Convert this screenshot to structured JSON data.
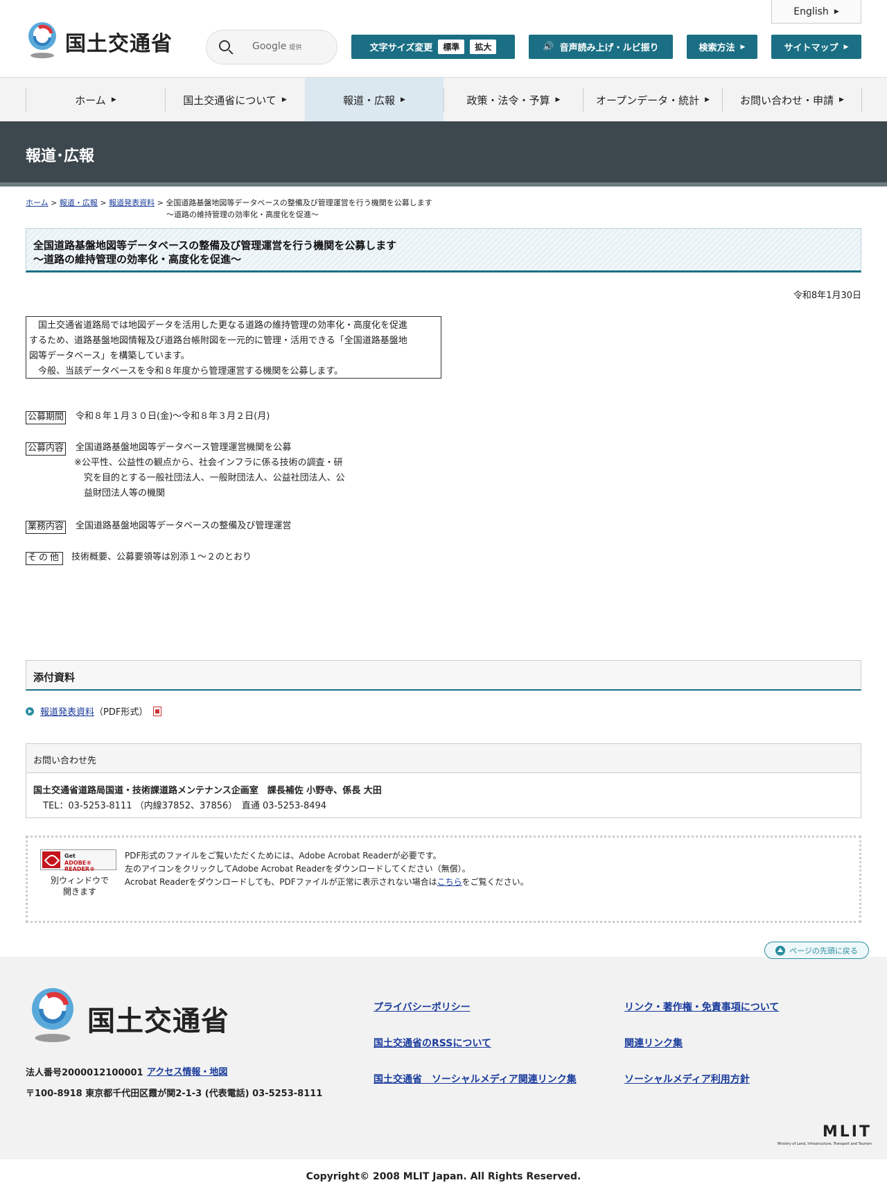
{
  "header": {
    "logo_text": "国土交通省",
    "search_placeholder": "Google",
    "search_provided": "提供",
    "english_label": "English",
    "font_size_label": "文字サイズ変更",
    "font_standard": "標準",
    "font_large": "拡大",
    "voice_label": "音声読み上げ・ルビ振り",
    "search_method_label": "検索方法",
    "sitemap_label": "サイトマップ"
  },
  "nav": {
    "items": [
      {
        "label": "ホーム"
      },
      {
        "label": "国土交通省について"
      },
      {
        "label": "報道・広報"
      },
      {
        "label": "政策・法令・予算"
      },
      {
        "label": "オープンデータ・統計"
      },
      {
        "label": "お問い合わせ・申請"
      }
    ]
  },
  "banner": {
    "title": "報道･広報"
  },
  "breadcrumb": {
    "home": "ホーム",
    "press": "報道・広報",
    "releases": "報道発表資料",
    "current_line1": "全国道路基盤地図等データベースの整備及び管理運営を行う機関を公募します",
    "current_line2": "～道路の維持管理の効率化・高度化を促進～"
  },
  "article": {
    "title_line1": "全国道路基盤地図等データベースの整備及び管理運営を行う機関を公募します",
    "title_line2": "～道路の維持管理の効率化・高度化を促進～",
    "date": "令和8年1月30日",
    "summary": [
      "　国土交通省道路局では地図データを活用した更なる道路の維持管理の効率化・高度化を促進",
      "するため、道路基盤地図情報及び道路台帳附図を一元的に管理・活用できる「全国道路基盤地",
      "図等データベース」を構築しています。",
      "　今般、当該データベースを令和８年度から管理運営する機関を公募します。"
    ],
    "period_label": "公募期間",
    "period_value": "令和８年１月３０日(金)～令和８年３月２日(月)",
    "content_label": "公募内容",
    "content_value": "全国道路基盤地図等データベース管理運営機関を公募",
    "content_note": [
      "※公平性、公益性の観点から、社会インフラに係る技術の調査・研",
      "究を目的とする一般社団法人、一般財団法人、公益社団法人、公",
      "益財団法人等の機関"
    ],
    "work_label": "業務内容",
    "work_value": "全国道路基盤地図等データベースの整備及び管理運営",
    "other_label": "その他",
    "other_value": "技術概要、公募要領等は別添１～２のとおり"
  },
  "attachments": {
    "heading": "添付資料",
    "link_label": "報道発表資料",
    "link_suffix": "（PDF形式）"
  },
  "contact": {
    "heading": "お問い合わせ先",
    "org": "国土交通省道路局国道・技術課道路メンテナンス企画室　課長補佐 小野寺、係長 大田",
    "tel": "TEL：03-5253-8111 （内線37852、37856）　直通 03-5253-8494"
  },
  "acrobat": {
    "badge_line1": "Get",
    "badge_line2": "ADOBE® READER®",
    "caption_line1": "別ウィンドウで",
    "caption_line2": "開きます",
    "line1": "PDF形式のファイルをご覧いただくためには、Adobe Acrobat Readerが必要です。",
    "line2": "左のアイコンをクリックしてAdobe Acrobat Readerをダウンロードしてください（無償）。",
    "line3_prefix": "Acrobat Readerをダウンロードしても、PDFファイルが正常に表示されない場合は",
    "line3_link": "こちら",
    "line3_suffix": "をご覧ください。"
  },
  "pagetop_label": "ページの先頭に戻る",
  "footer": {
    "logo_text": "国土交通省",
    "corp_number": "法人番号2000012100001",
    "access_link": "アクセス情報・地図",
    "address": "〒100-8918 東京都千代田区霞が関2-1-3 (代表電話) 03-5253-8111",
    "links_col1": [
      "プライバシーポリシー",
      "国土交通省のRSSについて",
      "国土交通省　ソーシャルメディア関連リンク集"
    ],
    "links_col2": [
      "リンク・著作権・免責事項について",
      "関連リンク集",
      "ソーシャルメディア利用方針"
    ],
    "mlit_logo": "MLIT",
    "mlit_sub": "Ministry of Land, Infrastructure, Transport and Tourism",
    "copyright": "Copyright© 2008 MLIT Japan. All Rights Reserved."
  },
  "colors": {
    "teal": "#1a6f84",
    "banner": "#3c484e",
    "link": "#1a3c9c"
  }
}
